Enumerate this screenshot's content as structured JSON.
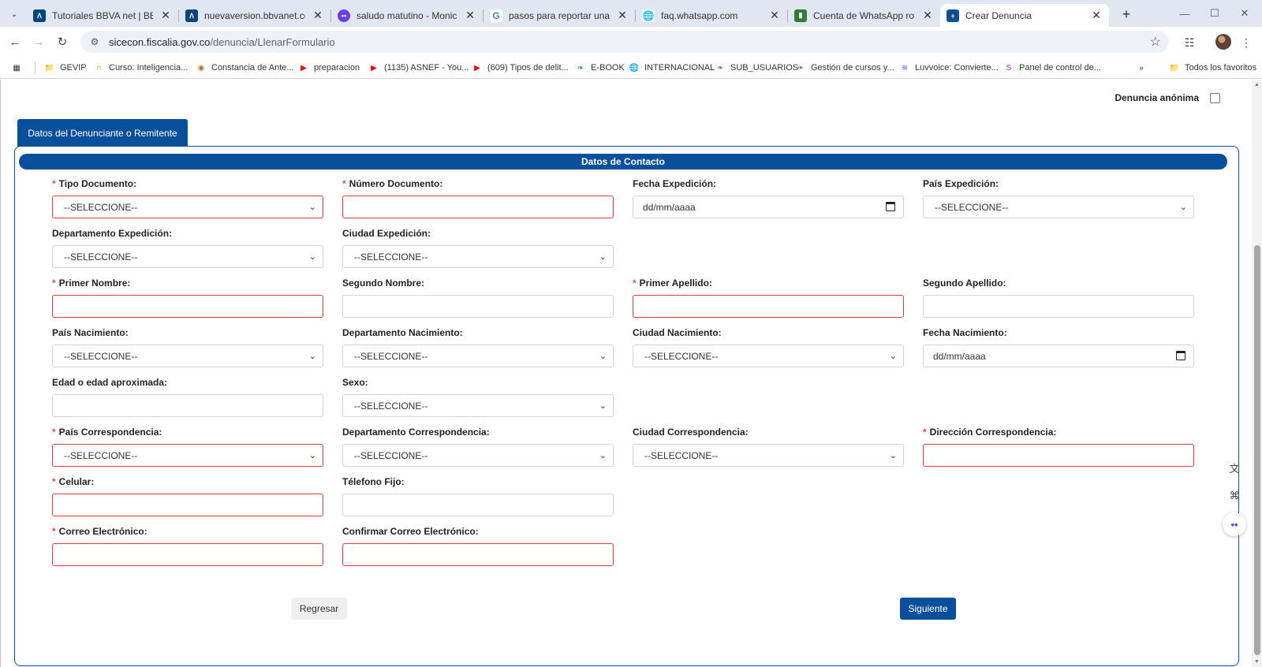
{
  "browser": {
    "tabs": [
      {
        "title": "Tutoriales BBVA net | BBVA Co",
        "favicon": "bbva-icon",
        "color": "#004481"
      },
      {
        "title": "nuevaversion.bbvanet.com.co/",
        "favicon": "bbva-icon",
        "color": "#004481"
      },
      {
        "title": "saludo matutino - Monica",
        "favicon": "monica-icon",
        "color": "#6a3df0"
      },
      {
        "title": "pasos para reportar una cuenta",
        "favicon": "google-icon",
        "color": "#4285f4"
      },
      {
        "title": "faq.whatsapp.com",
        "favicon": "globe-icon",
        "color": "#5f6368"
      },
      {
        "title": "Cuenta de WhatsApp robada o",
        "favicon": "bookmark-icon",
        "color": "#2e7d32"
      },
      {
        "title": "Crear Denuncia",
        "favicon": "fiscalia-icon",
        "color": "#0a4f9c"
      }
    ],
    "url_domain": "sicecon.fiscalia.gov.co",
    "url_path": "/denuncia/LlenarFormulario",
    "bookmarks": [
      {
        "label": "GEVIP",
        "icon": "folder-icon"
      },
      {
        "label": "Curso: Inteligencia...",
        "icon": "course-icon"
      },
      {
        "label": "Constancia de Ante...",
        "icon": "seal-icon"
      },
      {
        "label": "preparacion",
        "icon": "youtube-icon"
      },
      {
        "label": "(1135) ASNEF - You...",
        "icon": "youtube-icon"
      },
      {
        "label": "(609) Tipos de delit...",
        "icon": "youtube-icon"
      },
      {
        "label": "E-BOOK",
        "icon": "leaf-icon"
      },
      {
        "label": "INTERNACIONAL",
        "icon": "globe-icon"
      },
      {
        "label": "SUB_USUARIOS",
        "icon": "leaf-icon"
      },
      {
        "label": "Gestión de cursos y...",
        "icon": "leaf-icon"
      },
      {
        "label": "Luvvoice: Convierte...",
        "icon": "wave-icon"
      },
      {
        "label": "Panel de control de...",
        "icon": "s-icon"
      }
    ],
    "all_bookmarks": "Todos los favoritos"
  },
  "page": {
    "anonymous_label": "Denuncia anónima",
    "tab_label": "Datos del Denunciante o Remitente",
    "section_title": "Datos de Contacto",
    "select_placeholder": "--SELECCIONE--",
    "date_placeholder": "dd/mm/aaaa",
    "labels": {
      "tipo_documento": "Tipo Documento:",
      "numero_documento": "Número Documento:",
      "fecha_expedicion": "Fecha Expedición:",
      "pais_expedicion": "País Expedición:",
      "departamento_expedicion": "Departamento Expedición:",
      "ciudad_expedicion": "Ciudad Expedición:",
      "primer_nombre": "Primer Nombre:",
      "segundo_nombre": "Segundo Nombre:",
      "primer_apellido": "Primer Apellido:",
      "segundo_apellido": "Segundo Apellido:",
      "pais_nacimiento": "País Nacimiento:",
      "departamento_nacimiento": "Departamento Nacimiento:",
      "ciudad_nacimiento": "Ciudad Nacimiento:",
      "fecha_nacimiento": "Fecha Nacimiento:",
      "edad": "Edad o edad aproximada:",
      "sexo": "Sexo:",
      "pais_correspondencia": "País Correspondencia:",
      "departamento_correspondencia": "Departamento Correspondencia:",
      "ciudad_correspondencia": "Ciudad Correspondencia:",
      "direccion_correspondencia": "Dirección Correspondencia:",
      "celular": "Celular:",
      "telefono_fijo": "Télefono Fijo:",
      "correo": "Correo Electrónico:",
      "confirmar_correo": "Confirmar Correo Electrónico:"
    },
    "required_mark": "*",
    "back_button": "Regresar",
    "next_button": "Siguiente"
  },
  "colors": {
    "primary": "#0a4f9c",
    "invalid_border": "#e03c3c",
    "required_asterisk": "#d9534f"
  }
}
